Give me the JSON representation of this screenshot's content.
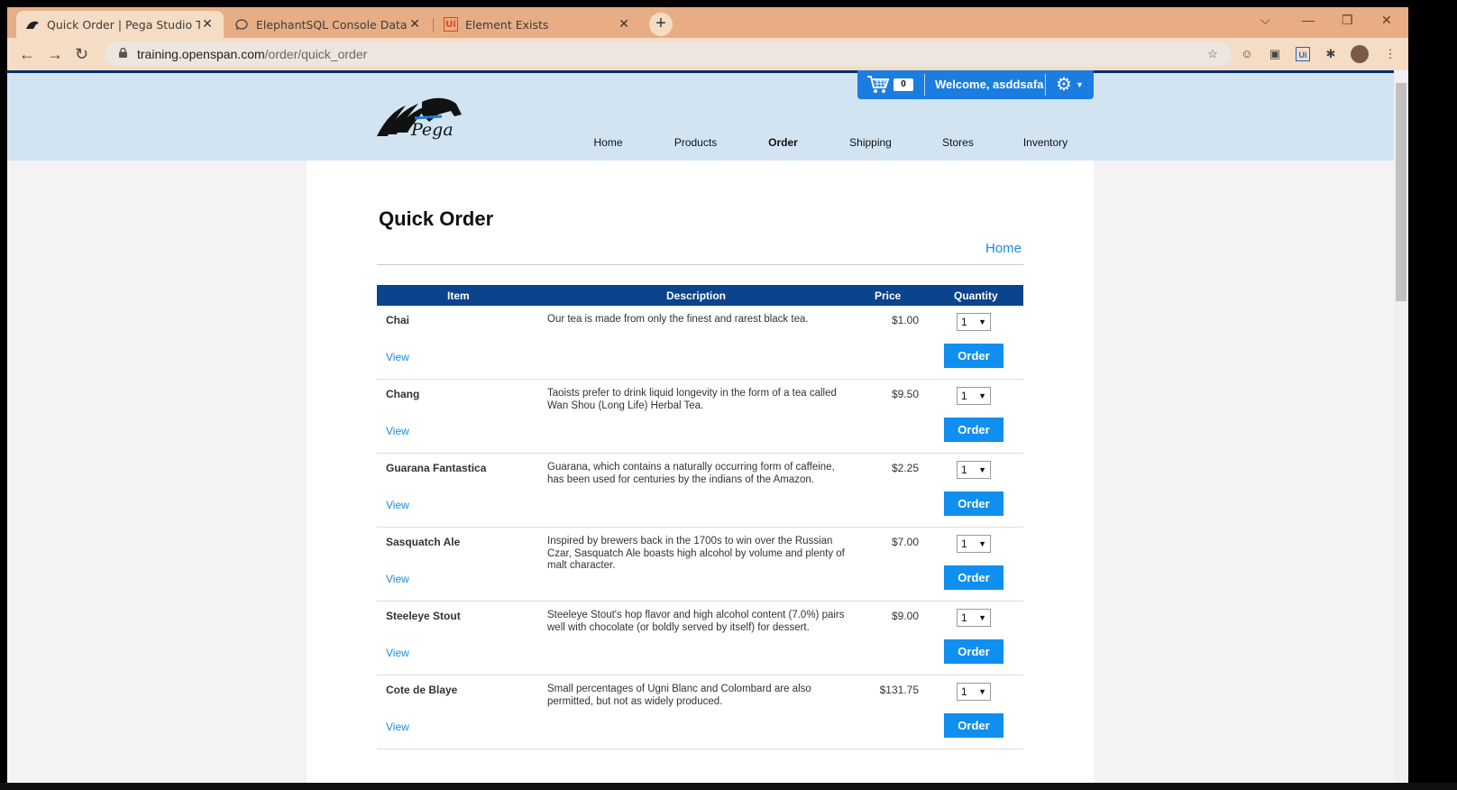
{
  "browser": {
    "tabs": [
      {
        "title": "Quick Order | Pega Studio Trainin",
        "icon": "pega-horse-icon",
        "active": true
      },
      {
        "title": "ElephantSQL Console DataBase f",
        "icon": "elephant-icon",
        "active": false
      },
      {
        "title": "Element Exists",
        "icon": "uipath-icon",
        "active": false
      }
    ],
    "url_host": "training.openspan.com",
    "url_path": "/order/quick_order"
  },
  "header": {
    "logo_text": "Pega",
    "cart_count": "0",
    "welcome": "Welcome, asddsafa",
    "nav": [
      "Home",
      "Products",
      "Order",
      "Shipping",
      "Stores",
      "Inventory"
    ],
    "current_nav": "Order"
  },
  "main": {
    "title": "Quick Order",
    "home_link": "Home",
    "columns": [
      "Item",
      "Description",
      "Price",
      "Quantity"
    ],
    "view_label": "View",
    "order_label": "Order",
    "rows": [
      {
        "name": "Chai",
        "desc": "Our tea is made from only the finest and rarest black tea.",
        "price": "$1.00",
        "qty": "1"
      },
      {
        "name": "Chang",
        "desc": "Taoists prefer to drink liquid longevity in the form of a tea called Wan Shou (Long Life) Herbal Tea.",
        "price": "$9.50",
        "qty": "1"
      },
      {
        "name": "Guarana Fantastica",
        "desc": "Guarana, which contains a naturally occurring form of caffeine, has been used for centuries by the indians of the Amazon.",
        "price": "$2.25",
        "qty": "1"
      },
      {
        "name": "Sasquatch Ale",
        "desc": "Inspired by brewers back in the 1700s to win over the Russian Czar, Sasquatch Ale boasts high alcohol by volume and plenty of malt character.",
        "price": "$7.00",
        "qty": "1"
      },
      {
        "name": "Steeleye Stout",
        "desc": "Steeleye Stout's hop flavor and high alcohol content (7.0%) pairs well with chocolate (or boldly served by itself) for dessert.",
        "price": "$9.00",
        "qty": "1"
      },
      {
        "name": "Cote de Blaye",
        "desc": "Small percentages of Ugni Blanc and Colombard are also permitted, but not as widely produced.",
        "price": "$131.75",
        "qty": "1"
      }
    ]
  }
}
